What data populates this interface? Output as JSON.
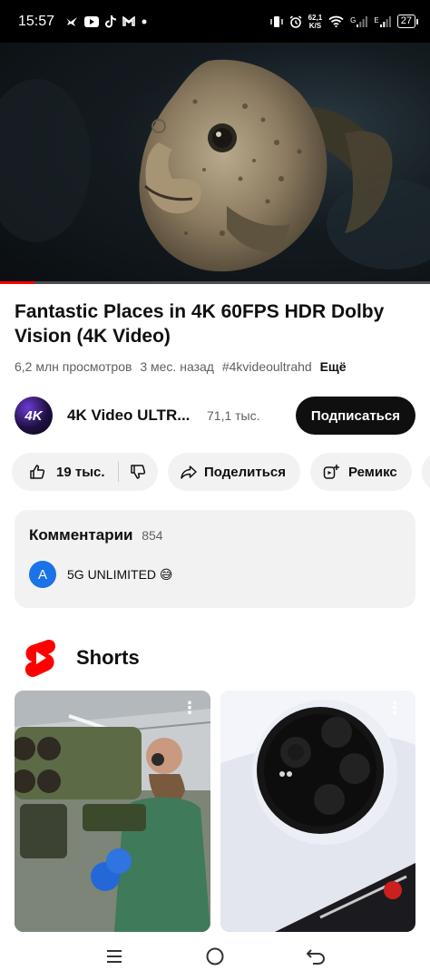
{
  "status_bar": {
    "time": "15:57",
    "net_speed_value": "62,1",
    "net_speed_unit": "K/S",
    "signal_1_label": "G",
    "signal_2_label": "E",
    "battery": "27"
  },
  "video": {
    "progress_fraction": 0.08
  },
  "details": {
    "title": "Fantastic Places in 4K 60FPS HDR Dolby Vision (4K Video)",
    "views": "6,2 млн просмотров",
    "age": "3 мес. назад",
    "hashtag": "#4kvideoultrahd",
    "more_label": "Ещё"
  },
  "channel": {
    "avatar_text": "4K",
    "name": "4K Video ULTR...",
    "subscribers": "71,1 тыс.",
    "subscribe_label": "Подписаться"
  },
  "actions": {
    "likes": "19 тыс.",
    "share_label": "Поделиться",
    "remix_label": "Ремикс"
  },
  "comments": {
    "heading": "Комментарии",
    "count": "854",
    "first_avatar_letter": "A",
    "first_text": "5G UNLIMITED 😅"
  },
  "shorts": {
    "heading": "Shorts",
    "card_menu_glyph": "⋮"
  },
  "colors": {
    "accent_red": "#ff0000",
    "subscribe_bg": "#0f0f0f",
    "pill_bg": "#f2f2f2",
    "comment_avatar": "#1a73e8"
  }
}
